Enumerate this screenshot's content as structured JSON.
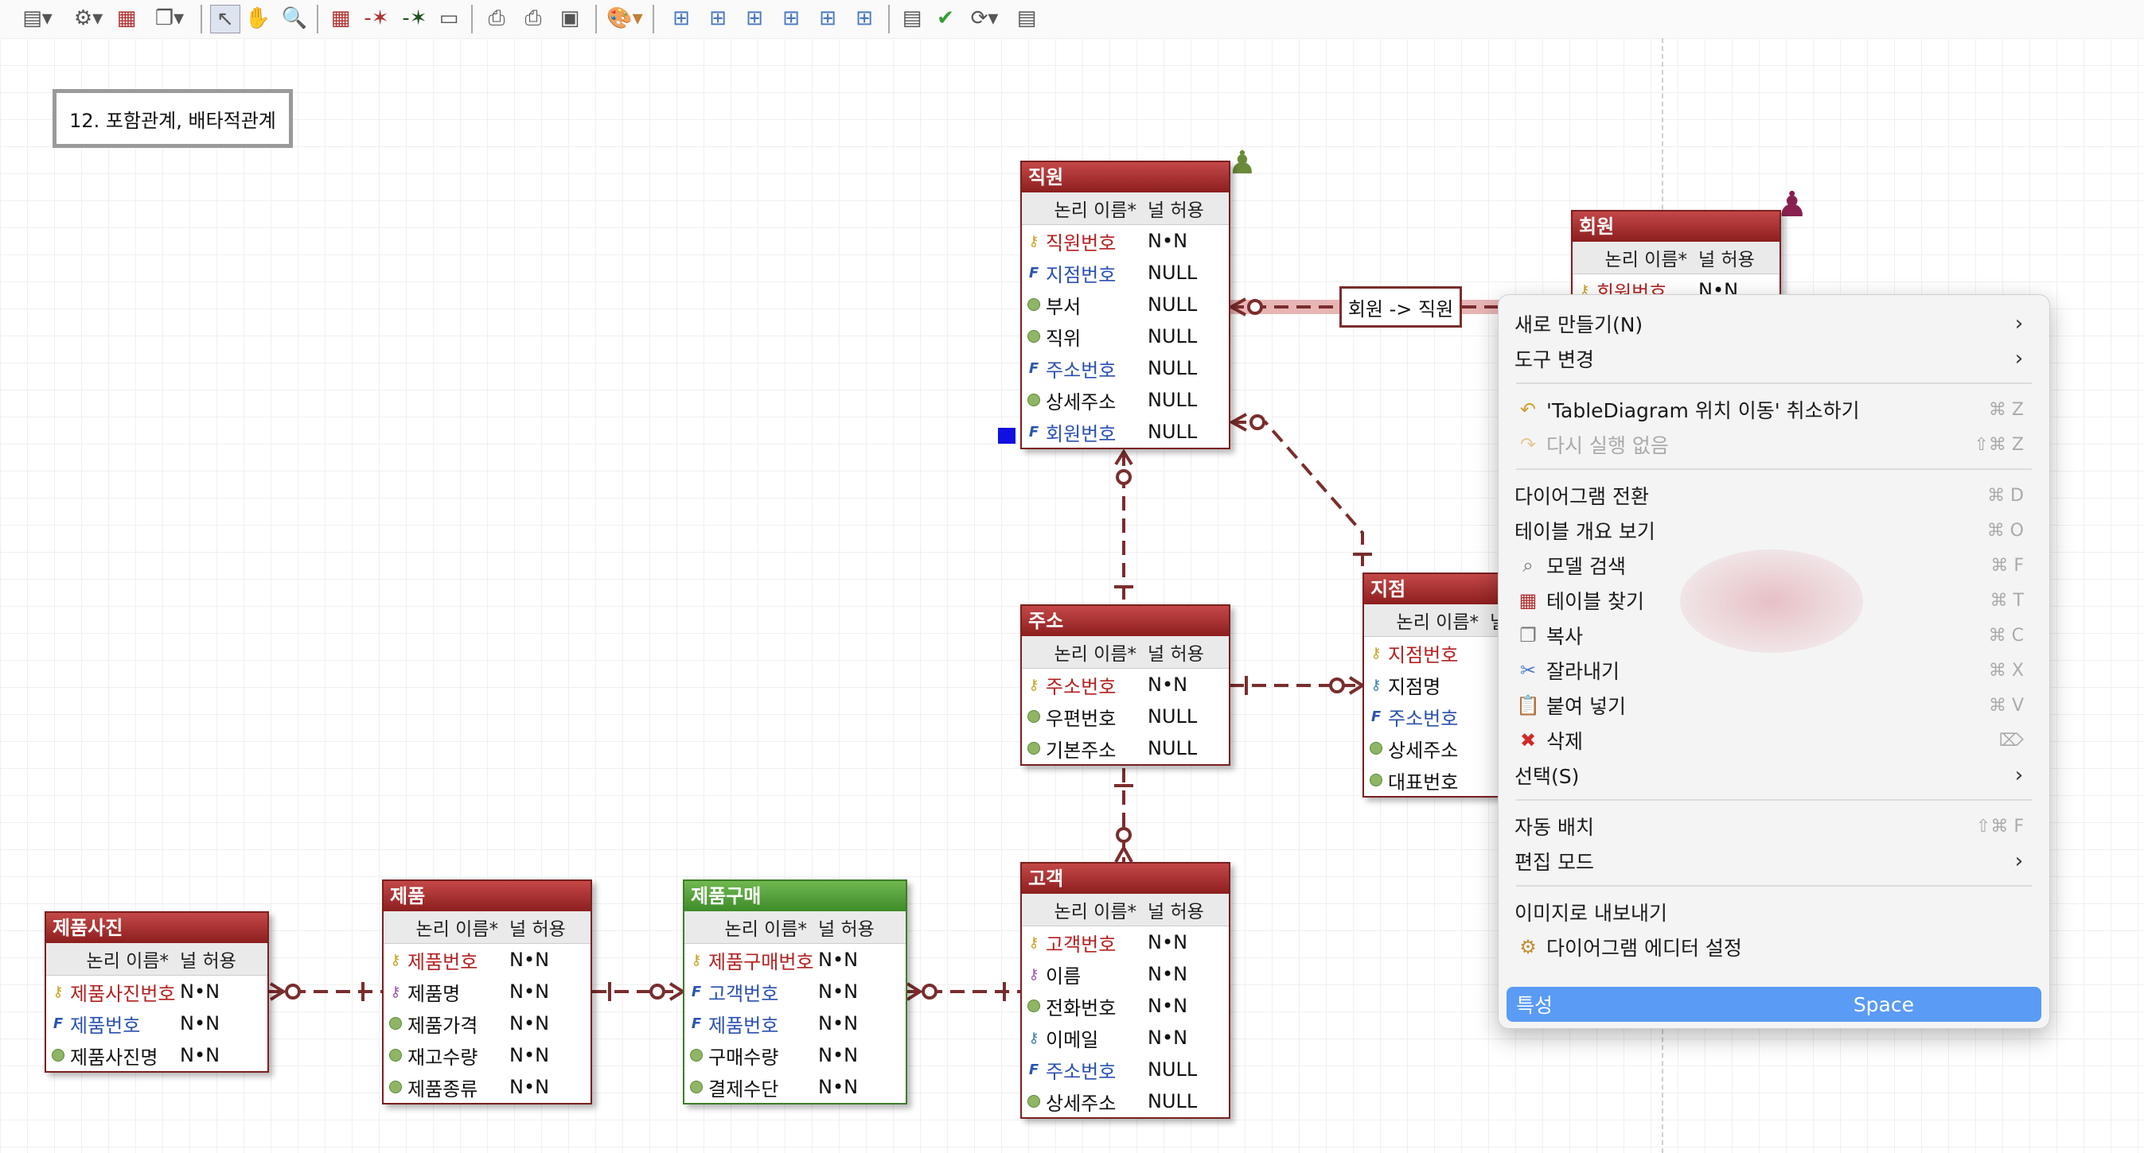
{
  "note": {
    "text": "12. 포함관계, 배타적관계"
  },
  "relationship_label": "회원 -> 직원",
  "header": {
    "logical_name": "논리 이름*",
    "null_allowed": "널 허용"
  },
  "entities": {
    "employee": {
      "title": "직원",
      "rows": [
        {
          "name": "직원번호",
          "null": "N•N",
          "kind": "pk"
        },
        {
          "name": "지점번호",
          "null": "NULL",
          "kind": "fk"
        },
        {
          "name": "부서",
          "null": "NULL",
          "kind": "attr"
        },
        {
          "name": "직위",
          "null": "NULL",
          "kind": "attr"
        },
        {
          "name": "주소번호",
          "null": "NULL",
          "kind": "fk"
        },
        {
          "name": "상세주소",
          "null": "NULL",
          "kind": "attr"
        },
        {
          "name": "회원번호",
          "null": "NULL",
          "kind": "fk"
        }
      ]
    },
    "member": {
      "title": "회원",
      "rows": [
        {
          "name": "회원번호",
          "null": "N•N",
          "kind": "pk"
        }
      ]
    },
    "branch": {
      "title": "지점",
      "rows": [
        {
          "name": "지점번호",
          "kind": "pk"
        },
        {
          "name": "지점명",
          "kind": "ak"
        },
        {
          "name": "주소번호",
          "kind": "fk"
        },
        {
          "name": "상세주소",
          "kind": "attr"
        },
        {
          "name": "대표번호",
          "kind": "attr"
        }
      ]
    },
    "address": {
      "title": "주소",
      "rows": [
        {
          "name": "주소번호",
          "null": "N•N",
          "kind": "pk"
        },
        {
          "name": "우편번호",
          "null": "NULL",
          "kind": "attr"
        },
        {
          "name": "기본주소",
          "null": "NULL",
          "kind": "attr"
        }
      ]
    },
    "customer": {
      "title": "고객",
      "rows": [
        {
          "name": "고객번호",
          "null": "N•N",
          "kind": "pk"
        },
        {
          "name": "이름",
          "null": "N•N",
          "kind": "ik"
        },
        {
          "name": "전화번호",
          "null": "N•N",
          "kind": "attr"
        },
        {
          "name": "이메일",
          "null": "N•N",
          "kind": "ak"
        },
        {
          "name": "주소번호",
          "null": "NULL",
          "kind": "fk"
        },
        {
          "name": "상세주소",
          "null": "NULL",
          "kind": "attr"
        }
      ]
    },
    "product_photo": {
      "title": "제품사진",
      "rows": [
        {
          "name": "제품사진번호",
          "null": "N•N",
          "kind": "pk"
        },
        {
          "name": "제품번호",
          "null": "N•N",
          "kind": "fk"
        },
        {
          "name": "제품사진명",
          "null": "N•N",
          "kind": "attr"
        }
      ]
    },
    "product": {
      "title": "제품",
      "rows": [
        {
          "name": "제품번호",
          "null": "N•N",
          "kind": "pk"
        },
        {
          "name": "제품명",
          "null": "N•N",
          "kind": "ik"
        },
        {
          "name": "제품가격",
          "null": "N•N",
          "kind": "attr"
        },
        {
          "name": "재고수량",
          "null": "N•N",
          "kind": "attr"
        },
        {
          "name": "제품종류",
          "null": "N•N",
          "kind": "attr"
        }
      ]
    },
    "purchase": {
      "title": "제품구매",
      "rows": [
        {
          "name": "제품구매번호",
          "null": "N•N",
          "kind": "pk"
        },
        {
          "name": "고객번호",
          "null": "N•N",
          "kind": "fk"
        },
        {
          "name": "제품번호",
          "null": "N•N",
          "kind": "fk"
        },
        {
          "name": "구매수량",
          "null": "N•N",
          "kind": "attr"
        },
        {
          "name": "결제수단",
          "null": "N•N",
          "kind": "attr"
        }
      ]
    }
  },
  "menu": {
    "new": "새로 만들기(N)",
    "change_tool": "도구 변경",
    "undo": "'TableDiagram 위치 이동' 취소하기",
    "undo_sc": "⌘ Z",
    "redo": "다시 실행 없음",
    "redo_sc": "⇧⌘ Z",
    "switch_diagram": "다이어그램 전환",
    "switch_diagram_sc": "⌘ D",
    "table_overview": "테이블 개요 보기",
    "table_overview_sc": "⌘ O",
    "model_search": "모델 검색",
    "model_search_sc": "⌘ F",
    "find_table": "테이블 찾기",
    "find_table_sc": "⌘ T",
    "copy": "복사",
    "copy_sc": "⌘ C",
    "cut": "잘라내기",
    "cut_sc": "⌘ X",
    "paste": "붙여 넣기",
    "paste_sc": "⌘ V",
    "delete": "삭제",
    "delete_sc": "⌦",
    "select": "선택(S)",
    "auto_layout": "자동 배치",
    "auto_layout_sc": "⇧⌘ F",
    "edit_mode": "편집 모드",
    "export_image": "이미지로 내보내기",
    "editor_settings": "다이어그램 에디터 설정",
    "properties": "특성",
    "properties_sc": "Space"
  },
  "colors": {
    "entity_title": "#a32a2a",
    "entity_green": "#4d9a35",
    "relation": "#7a2d2d",
    "menu_selected": "#5a9bf5"
  }
}
